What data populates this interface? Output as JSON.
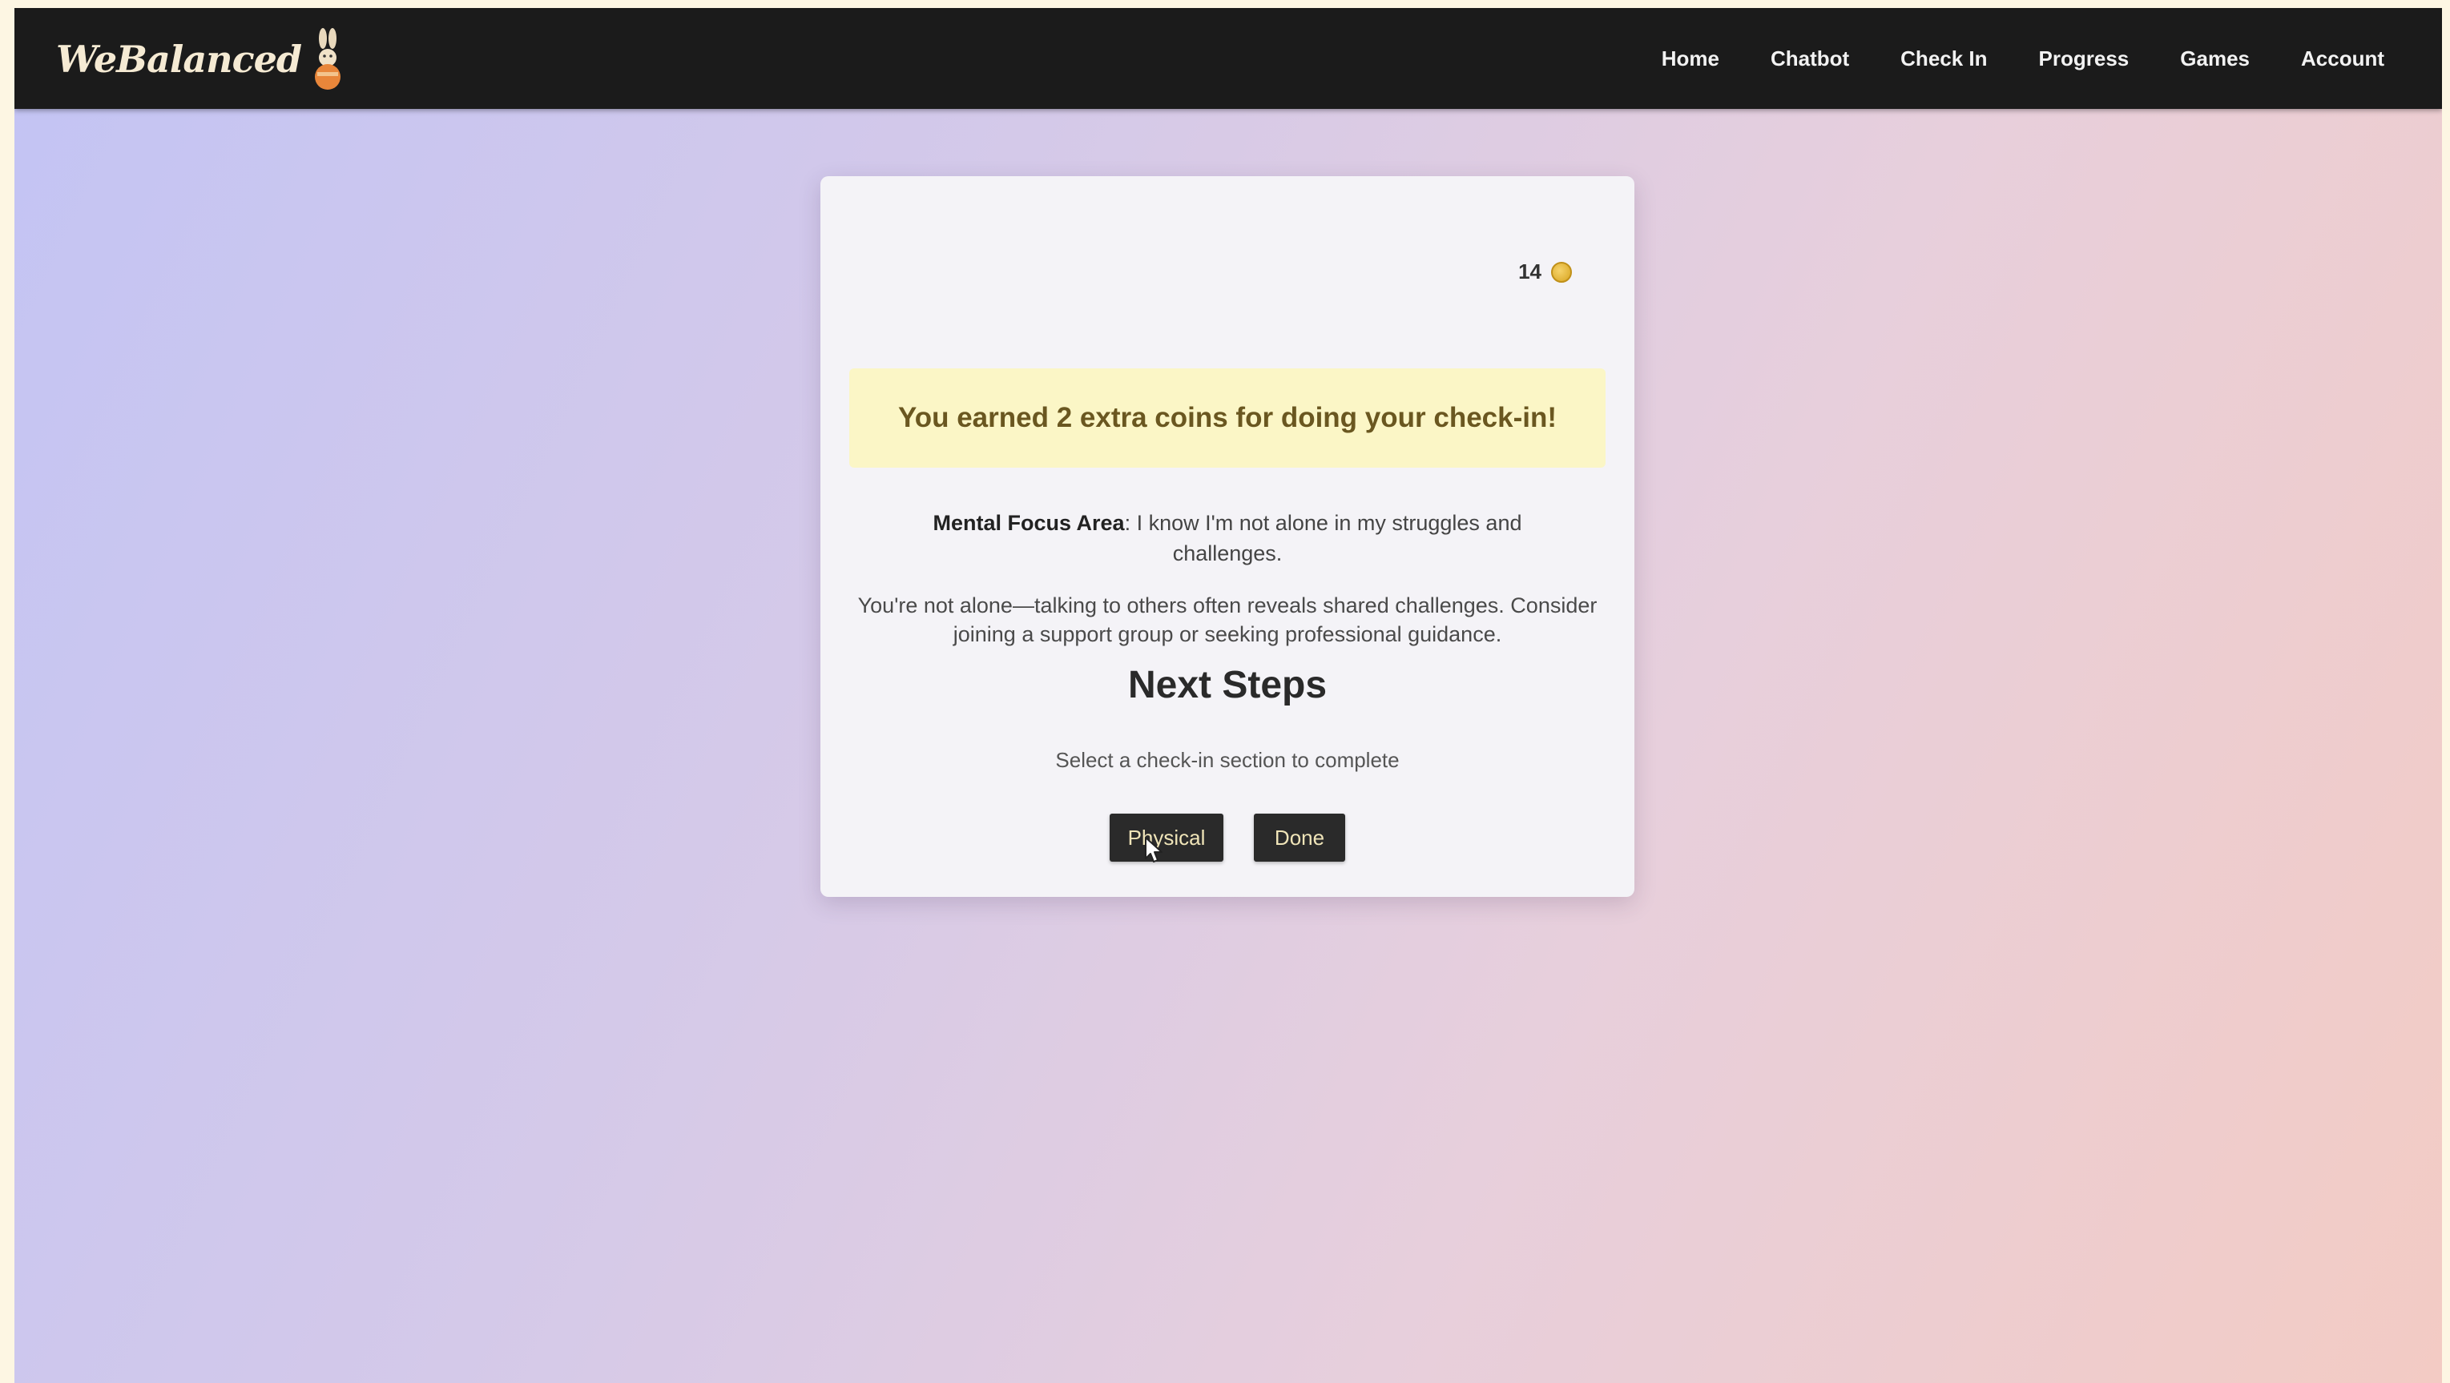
{
  "navbar": {
    "brand": "WeBalanced",
    "links": [
      "Home",
      "Chatbot",
      "Check In",
      "Progress",
      "Games",
      "Account"
    ]
  },
  "card": {
    "coins": "14",
    "banner": "You earned 2 extra coins for doing your check-in!",
    "focus_label": "Mental Focus Area",
    "focus_text": ": I know I'm not alone in my struggles and challenges.",
    "advice": "You're not alone—talking to others often reveals shared challenges. Consider joining a support group or seeking professional guidance.",
    "next_title": "Next Steps",
    "next_subtitle": "Select a check-in section to complete",
    "buttons": {
      "physical": "Physical",
      "done": "Done"
    }
  },
  "colors": {
    "navbar_bg": "#1b1b1b",
    "banner_bg": "#fbf6c6",
    "button_bg": "#2a2a2a",
    "button_text": "#efe4b8"
  },
  "icons": {
    "brand_logo": "bunny-logo-icon",
    "coin": "coin-icon",
    "cursor": "mouse-pointer-icon"
  }
}
